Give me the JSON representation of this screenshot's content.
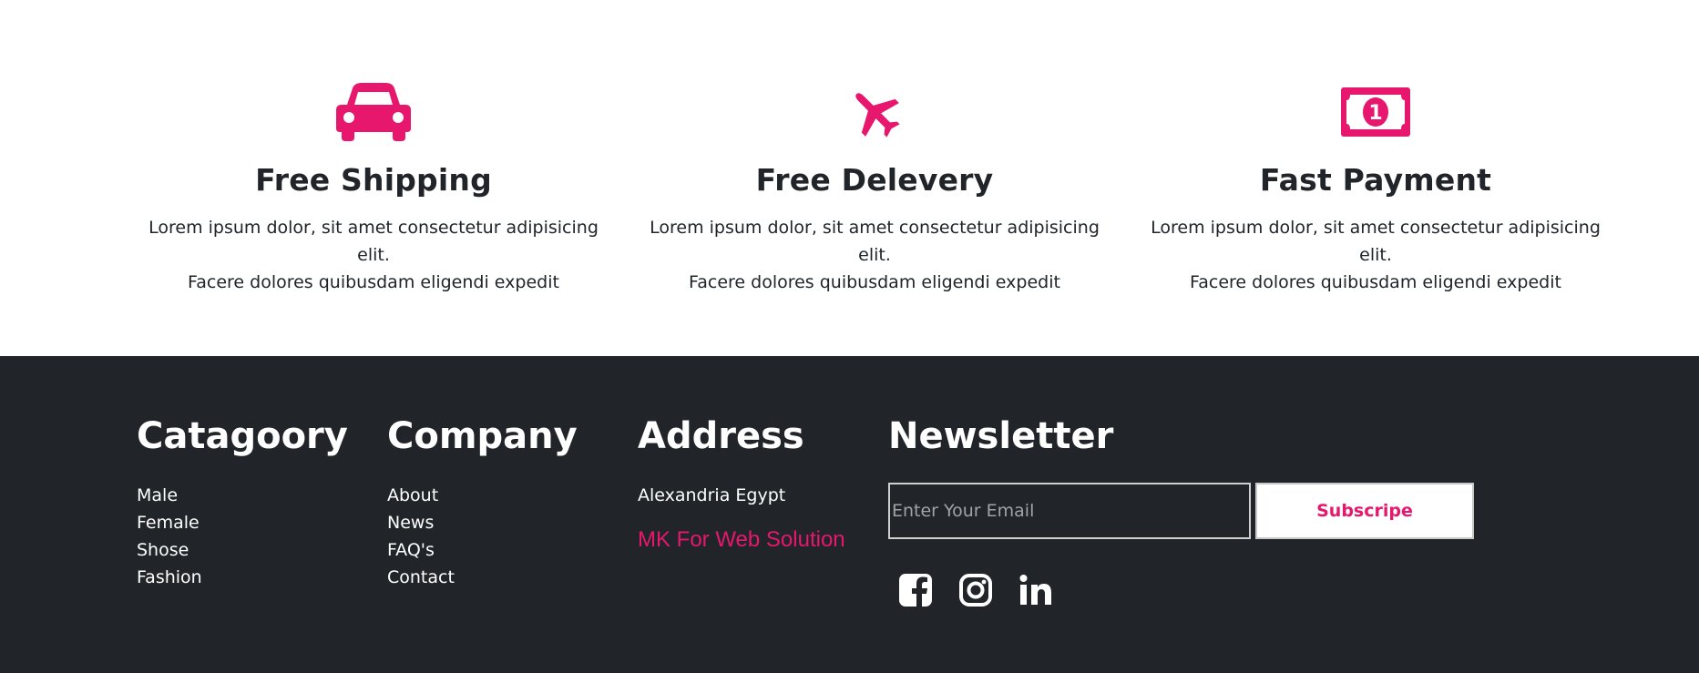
{
  "features": [
    {
      "icon": "car-icon",
      "title": "Free Shipping",
      "line1": "Lorem ipsum dolor, sit amet consectetur adipisicing elit.",
      "line2": "Facere dolores quibusdam eligendi expedit"
    },
    {
      "icon": "plane-icon",
      "title": "Free Delevery",
      "line1": "Lorem ipsum dolor, sit amet consectetur adipisicing elit.",
      "line2": "Facere dolores quibusdam eligendi expedit"
    },
    {
      "icon": "money-bill-icon",
      "title": "Fast Payment",
      "line1": "Lorem ipsum dolor, sit amet consectetur adipisicing elit.",
      "line2": "Facere dolores quibusdam eligendi expedit"
    }
  ],
  "footer": {
    "category": {
      "title": "Catagoory",
      "items": [
        "Male",
        "Female",
        "Shose",
        "Fashion"
      ]
    },
    "company": {
      "title": "Company",
      "items": [
        "About",
        "News",
        "FAQ's",
        "Contact"
      ]
    },
    "address": {
      "title": "Address",
      "text": "Alexandria Egypt",
      "brand": "MK For Web Solution"
    },
    "newsletter": {
      "title": "Newsletter",
      "placeholder": "Enter Your Email",
      "button": "Subscripe"
    },
    "social": [
      "facebook-icon",
      "instagram-icon",
      "linkedin-icon"
    ]
  },
  "colors": {
    "accent": "#e6176c",
    "footer_bg": "#212529",
    "text": "#212529"
  }
}
